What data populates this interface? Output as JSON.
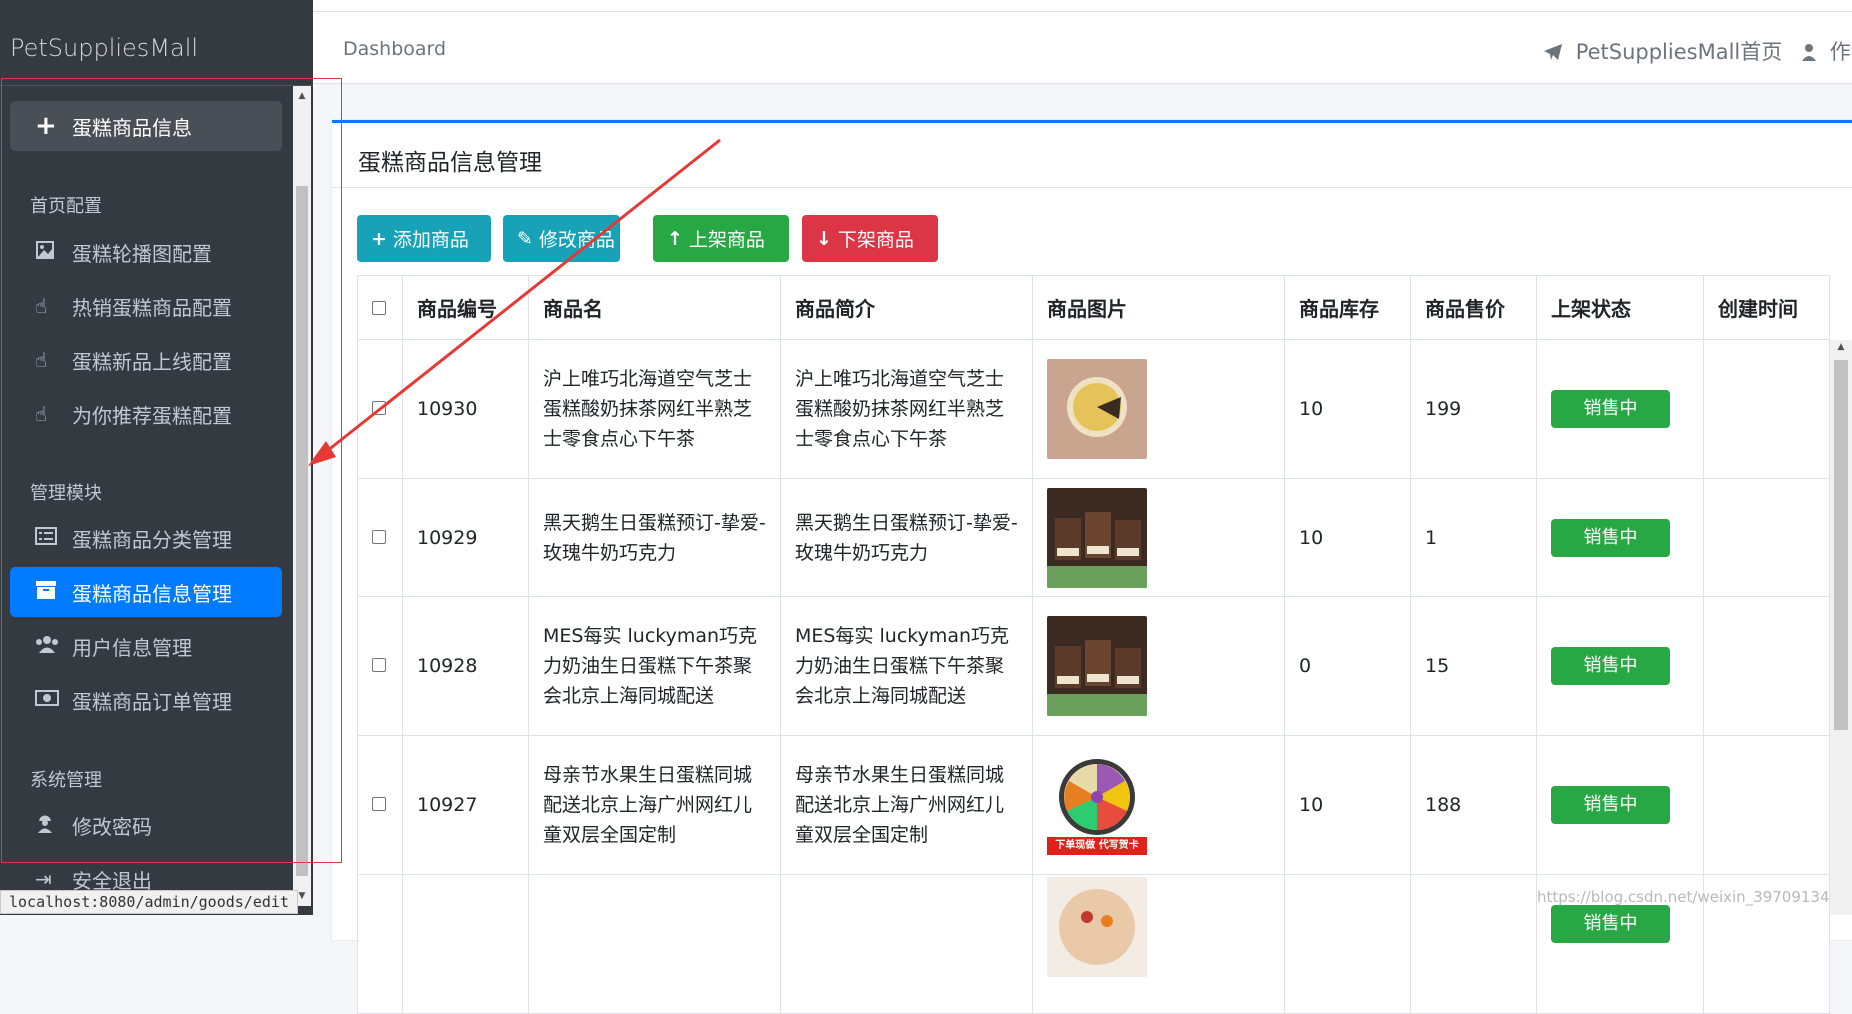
{
  "brand": "PetSuppliesMall",
  "sidebar": {
    "top_item": {
      "label": "蛋糕商品信息",
      "icon": "plus-icon"
    },
    "sections": [
      {
        "title": "首页配置",
        "items": [
          {
            "label": "蛋糕轮播图配置",
            "icon": "image-icon"
          },
          {
            "label": "热销蛋糕商品配置",
            "icon": "hand-pointer-icon"
          },
          {
            "label": "蛋糕新品上线配置",
            "icon": "hand-pointer-icon"
          },
          {
            "label": "为你推荐蛋糕配置",
            "icon": "hand-pointer-icon"
          }
        ]
      },
      {
        "title": "管理模块",
        "items": [
          {
            "label": "蛋糕商品分类管理",
            "icon": "list-icon"
          },
          {
            "label": "蛋糕商品信息管理",
            "icon": "archive-icon",
            "active": true
          },
          {
            "label": "用户信息管理",
            "icon": "users-icon"
          },
          {
            "label": "蛋糕商品订单管理",
            "icon": "money-icon"
          }
        ]
      },
      {
        "title": "系统管理",
        "items": [
          {
            "label": "修改密码",
            "icon": "user-secret-icon"
          },
          {
            "label": "安全退出",
            "icon": "sign-out-icon"
          }
        ]
      }
    ]
  },
  "status_url": "localhost:8080/admin/goods/edit",
  "header": {
    "breadcrumb": "Dashboard",
    "home_link": "PetSuppliesMall首页",
    "user_label": "作者"
  },
  "card": {
    "title": "蛋糕商品信息管理"
  },
  "toolbar": {
    "add": {
      "label": "添加商品",
      "icon": "plus-icon",
      "color": "#17a2b8"
    },
    "edit": {
      "label": "修改商品",
      "icon": "edit-icon",
      "color": "#17a2b8"
    },
    "up": {
      "label": "上架商品",
      "icon": "arrow-up-icon",
      "color": "#28a745"
    },
    "down": {
      "label": "下架商品",
      "icon": "arrow-down-icon",
      "color": "#dc3545"
    }
  },
  "table": {
    "columns": [
      "商品编号",
      "商品名",
      "商品简介",
      "商品图片",
      "商品库存",
      "商品售价",
      "上架状态",
      "创建时间"
    ],
    "rows": [
      {
        "id": "10930",
        "name": "沪上唯巧北海道空气芝士蛋糕酸奶抹茶网红半熟芝士零食点心下午茶",
        "intro": "沪上唯巧北海道空气芝士蛋糕酸奶抹茶网红半熟芝士零食点心下午茶",
        "stock": "10",
        "price": "199",
        "status": "销售中",
        "created": ""
      },
      {
        "id": "10929",
        "name": "黑天鹅生日蛋糕预订-挚爱-玫瑰牛奶巧克力",
        "intro": "黑天鹅生日蛋糕预订-挚爱-玫瑰牛奶巧克力",
        "stock": "10",
        "price": "1",
        "status": "销售中",
        "created": ""
      },
      {
        "id": "10928",
        "name": "MES每实 luckyman巧克力奶油生日蛋糕下午茶聚会北京上海同城配送",
        "intro": "MES每实 luckyman巧克力奶油生日蛋糕下午茶聚会北京上海同城配送",
        "stock": "0",
        "price": "15",
        "status": "销售中",
        "created": ""
      },
      {
        "id": "10927",
        "name": "母亲节水果生日蛋糕同城配送北京上海广州网红儿童双层全国定制",
        "intro": "母亲节水果生日蛋糕同城配送北京上海广州网红儿童双层全国定制",
        "stock": "10",
        "price": "188",
        "status": "销售中",
        "created": ""
      },
      {
        "id": "",
        "name": "",
        "intro": "",
        "stock": "",
        "price": "",
        "status": "销售中",
        "created": ""
      }
    ],
    "image_badge": "下单现做 代写贺卡"
  },
  "watermark": "https://blog.csdn.net/weixin_39709134"
}
